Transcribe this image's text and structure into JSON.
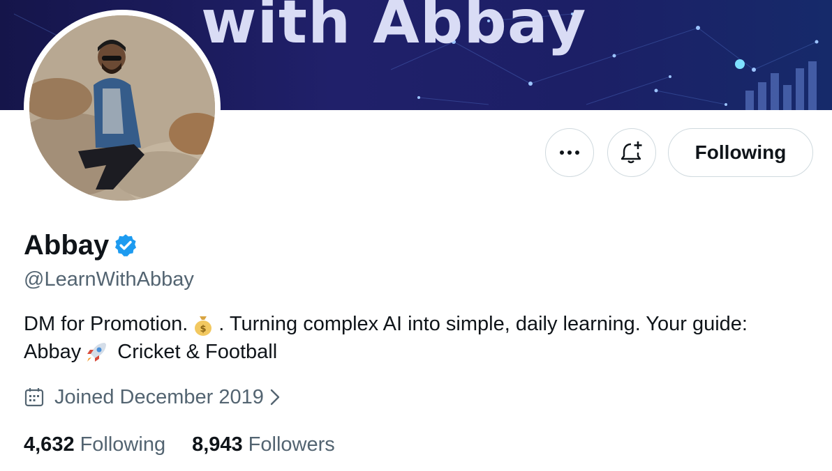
{
  "banner": {
    "title": "with Abbay"
  },
  "profile": {
    "name": "Abbay",
    "handle": "@LearnWithAbbay",
    "verified": true,
    "bio_part1": "DM for Promotion.",
    "bio_emoji1": "money-bag",
    "bio_part2": ". Turning complex AI into simple, daily learning. Your guide:",
    "bio_part3": "Abbay",
    "bio_emoji2": "rocket",
    "bio_part4": "Cricket & Football",
    "joined": "Joined December 2019"
  },
  "actions": {
    "more_icon": "more-horizontal-icon",
    "notify_icon": "bell-plus-icon",
    "following_label": "Following"
  },
  "stats": {
    "following_count": "4,632",
    "following_label": "Following",
    "followers_count": "8,943",
    "followers_label": "Followers"
  },
  "colors": {
    "verified": "#1d9bf0",
    "secondary_text": "#536471",
    "border": "#cfd9de",
    "banner": "#1c1f66"
  }
}
